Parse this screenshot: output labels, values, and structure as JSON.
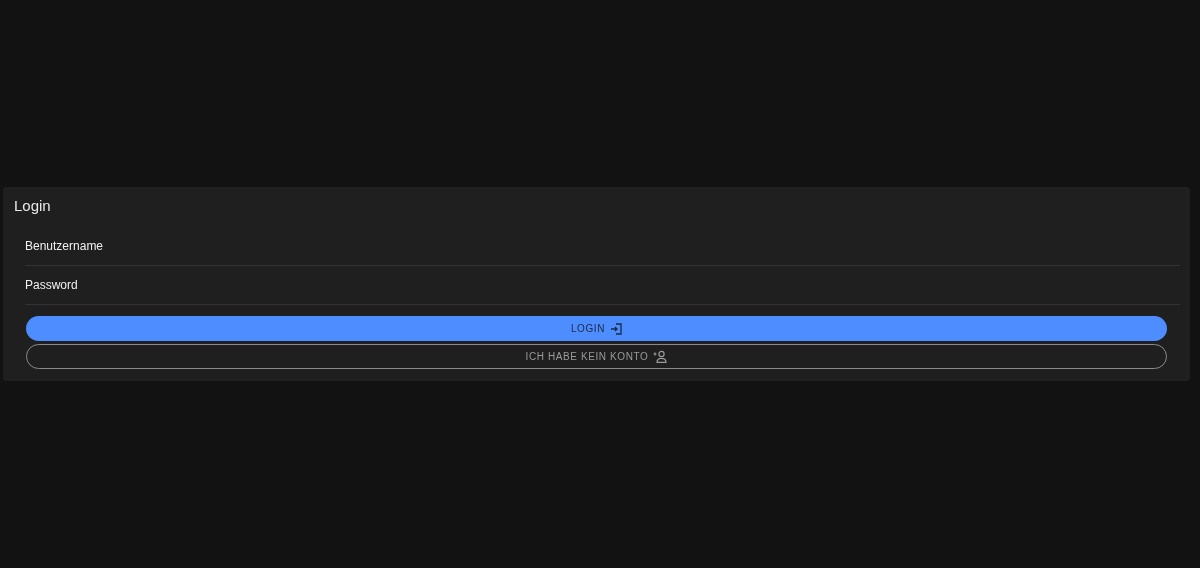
{
  "card": {
    "title": "Login"
  },
  "fields": [
    {
      "placeholder": "Benutzername"
    },
    {
      "placeholder": "Password"
    }
  ],
  "buttons": [
    {
      "label": "LOGIN",
      "kind": "primary"
    },
    {
      "label": "ICH HABE KEIN KONTO",
      "kind": "outlined"
    }
  ]
}
